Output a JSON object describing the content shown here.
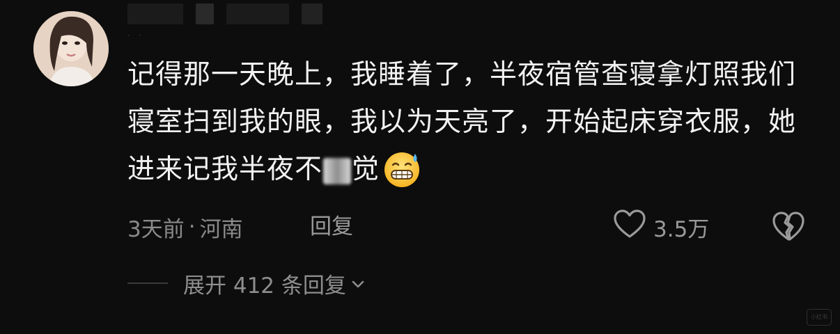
{
  "comment": {
    "text_before_censor": "记得那一天晚上，我睡着了，半夜宿管查寝拿灯照我们寝室扫到我的眼，我以为天亮了，开始起床穿衣服，她进来记我半夜不",
    "text_after_censor": "觉",
    "emoji": "grinning-sweat-emoji"
  },
  "meta": {
    "time": "3天前",
    "separator": "·",
    "location": "河南",
    "reply_label": "回复"
  },
  "actions": {
    "like_icon": "heart-outline-icon",
    "like_count": "3.5万",
    "dislike_icon": "broken-heart-icon"
  },
  "replies": {
    "expand_label": "展开 412 条回复",
    "chevron_icon": "chevron-down-icon"
  },
  "watermark": {
    "text": "小红书"
  }
}
